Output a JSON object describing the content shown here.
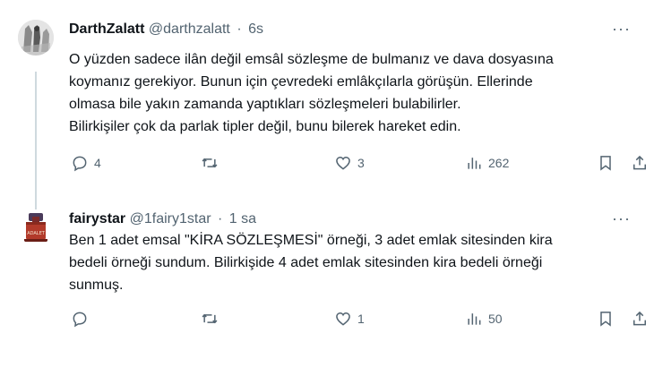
{
  "tweets": [
    {
      "name": "DarthZalatt",
      "handle": "@darthzalatt",
      "time": "6s",
      "text_lines": [
        "O yüzden sadece ilân değil emsâl sözleşme de bulmanız ve dava dosyasına",
        "koymanız gerekiyor. Bunun için çevredeki emlâkçılarla görüşün. Ellerinde",
        "olmasa bile yakın zamanda yaptıkları sözleşmeleri bulabilirler.",
        "Bilirkişiler çok da parlak tipler değil, bunu bilerek hareket edin."
      ],
      "replies": "4",
      "retweets": "",
      "likes": "3",
      "views": "262"
    },
    {
      "name": "fairystar",
      "handle": "@1fairy1star",
      "time": "1 sa",
      "text_lines": [
        "Ben 1 adet emsal \"KİRA SÖZLEŞMESİ\" örneği, 3 adet emlak sitesinden kira",
        "bedeli örneği sundum. Bilirkişide 4 adet emlak sitesinden kira bedeli örneği",
        "sunmuş."
      ],
      "replies": "",
      "retweets": "",
      "likes": "1",
      "views": "50",
      "avatar_badge": "ADALET"
    }
  ],
  "separator": "·",
  "more_glyph": "···",
  "icons": {
    "reply": "reply-icon",
    "retweet": "retweet-icon",
    "like": "heart-icon",
    "views": "views-icon",
    "bookmark": "bookmark-icon",
    "share": "share-icon",
    "more": "more-icon"
  },
  "colors": {
    "text": "#0f1419",
    "secondary": "#536471",
    "thread_line": "#cfd9de"
  }
}
